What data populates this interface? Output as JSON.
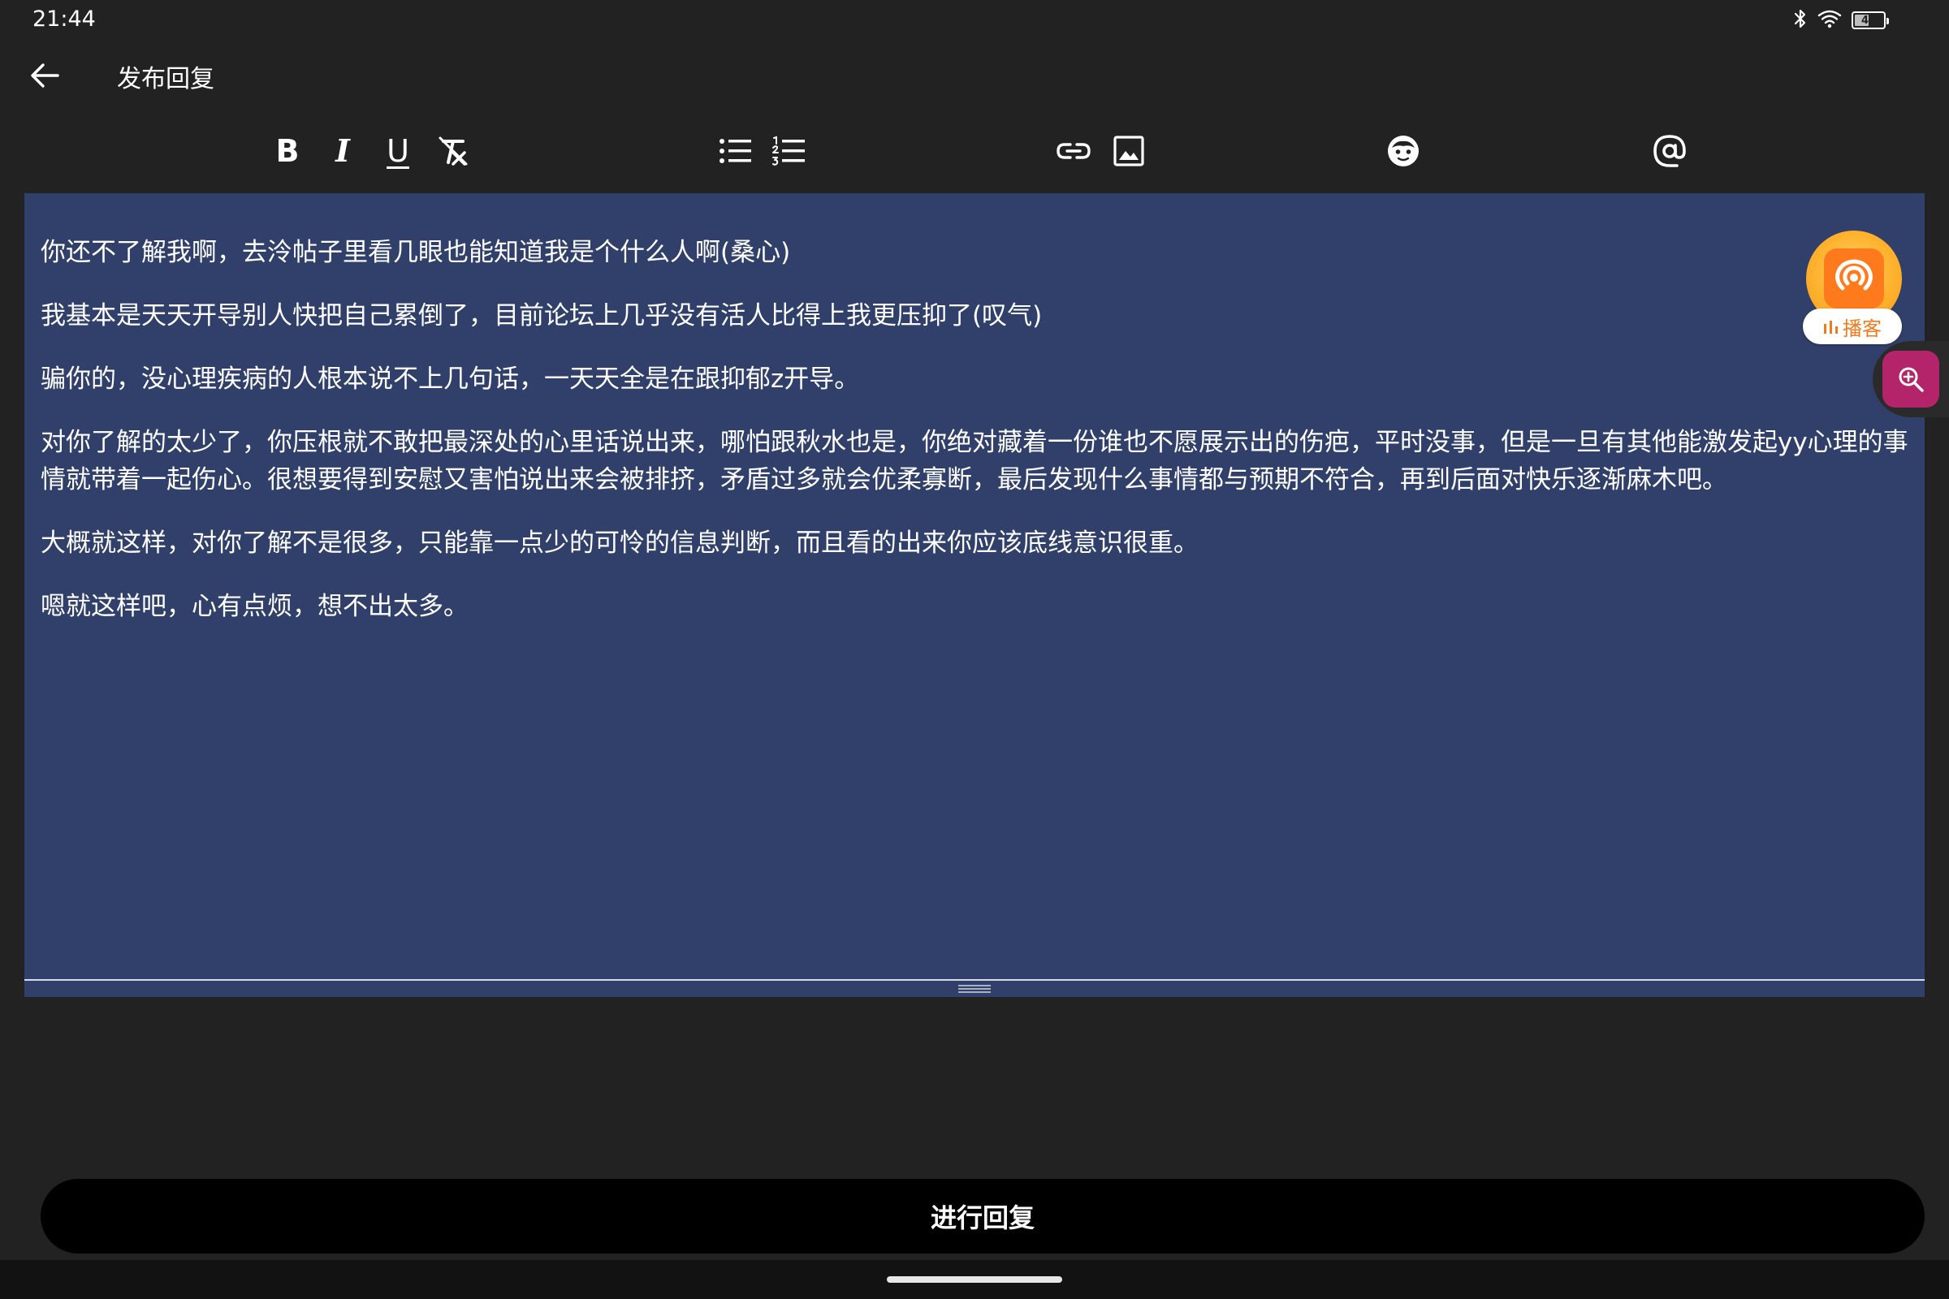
{
  "status_bar": {
    "time": "21:44",
    "battery": "49",
    "battery_level": 0.49,
    "icons": [
      "bluetooth-icon",
      "wifi-icon",
      "battery-icon"
    ]
  },
  "header": {
    "title": "发布回复",
    "back_icon": "arrow-left-icon"
  },
  "toolbar": {
    "bold": "B",
    "italic": "I",
    "underline": "U",
    "tools": [
      "bold",
      "italic",
      "underline",
      "clear-format",
      "bullet-list",
      "numbered-list",
      "link",
      "image",
      "emoji",
      "mention"
    ]
  },
  "editor": {
    "paragraphs": [
      "你还不了解我啊，去泠帖子里看几眼也能知道我是个什么人啊(桑心)",
      "我基本是天天开导别人快把自己累倒了，目前论坛上几乎没有活人比得上我更压抑了(叹气)",
      "骗你的，没心理疾病的人根本说不上几句话，一天天全是在跟抑郁z开导。",
      "对你了解的太少了，你压根就不敢把最深处的心里话说出来，哪怕跟秋水也是，你绝对藏着一份谁也不愿展示出的伤疤，平时没事，但是一旦有其他能激发起yy心理的事情就带着一起伤心。很想要得到安慰又害怕说出来会被排挤，矛盾过多就会优柔寡断，最后发现什么事情都与预期不符合，再到后面对快乐逐渐麻木吧。",
      "大概就这样，对你了解不是很多，只能靠一点少的可怜的信息判断，而且看的出来你应该底线意识很重。",
      "嗯就这样吧，心有点烦，想不出太多。"
    ],
    "background_color": "#31406a"
  },
  "podcast_widget": {
    "label": "播客",
    "accent": "#f27a1a"
  },
  "zoom_button": {
    "icon": "zoom-in-icon",
    "color": "#b4246a"
  },
  "reply_button": {
    "label": "进行回复"
  }
}
